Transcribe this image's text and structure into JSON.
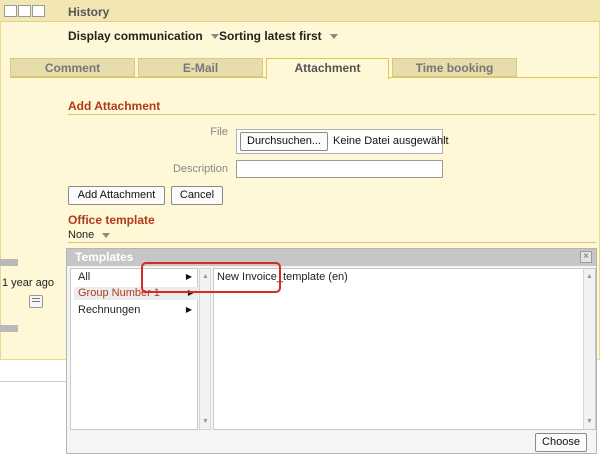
{
  "history": {
    "title": "History",
    "display": "Display communication",
    "sorting": "Sorting latest first"
  },
  "tabs": [
    "Comment",
    "E-Mail",
    "Attachment",
    "Time booking"
  ],
  "active_tab": "Attachment",
  "attachment": {
    "title": "Add Attachment",
    "file_label": "File",
    "browse_button": "Durchsuchen...",
    "no_file": "Keine Datei ausgewählt",
    "description_label": "Description",
    "description_value": "",
    "add_button": "Add Attachment",
    "cancel_button": "Cancel"
  },
  "office_template": {
    "title": "Office template",
    "selected": "None"
  },
  "timeline": {
    "timestamp": "1 year ago"
  },
  "dialog": {
    "title": "Templates",
    "categories": [
      "All",
      "Group Number 1",
      "Rechnungen"
    ],
    "selected_category": "Group Number 1",
    "templates": [
      "New Invoice_template (en)"
    ],
    "choose_button": "Choose"
  },
  "colors": {
    "section_title": "#b03a1d",
    "highlight_box": "#d92a2a",
    "panel_bg": "#fff8d6"
  },
  "icons": [
    "view-mode-icons",
    "chevron-down-icon",
    "comment-icon",
    "close-icon",
    "chevron-right-icon",
    "scroll-arrow-icon"
  ]
}
